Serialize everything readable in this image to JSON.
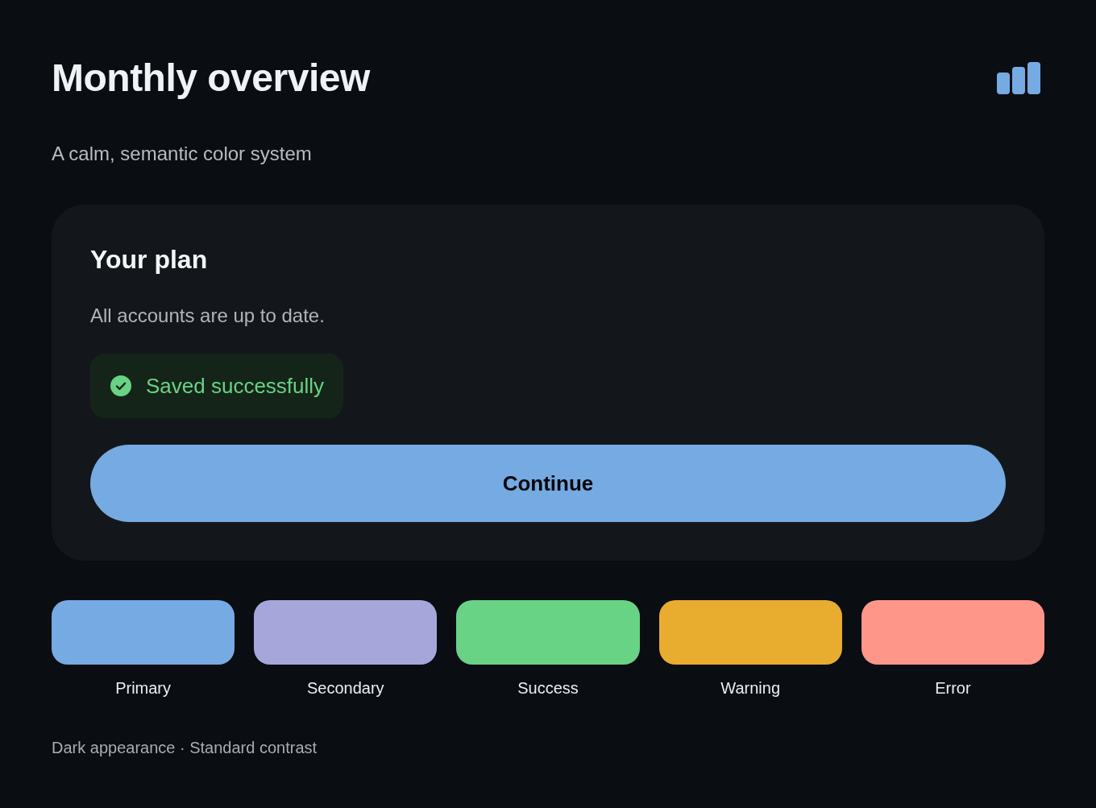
{
  "header": {
    "title": "Monthly overview",
    "subtitle": "A calm, semantic color system"
  },
  "card": {
    "title": "Your plan",
    "message": "All accounts are up to date.",
    "alert": {
      "kind": "success",
      "text": "Saved successfully"
    },
    "button": {
      "label": "Continue"
    }
  },
  "swatches": [
    {
      "label": "Primary",
      "color": "#76aae3"
    },
    {
      "label": "Secondary",
      "color": "#a7a6da"
    },
    {
      "label": "Success",
      "color": "#68d285"
    },
    {
      "label": "Warning",
      "color": "#e8ac2e"
    },
    {
      "label": "Error",
      "color": "#fe968a"
    }
  ],
  "footer": "Dark appearance · Standard contrast"
}
